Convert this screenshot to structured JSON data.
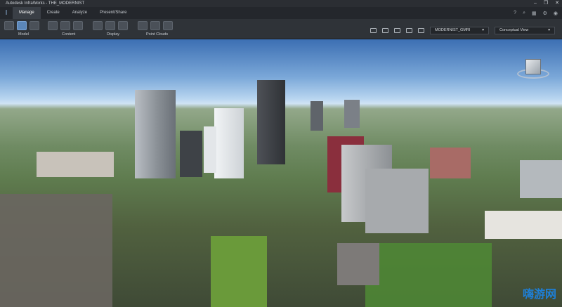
{
  "window": {
    "title": "Autodesk InfraWorks - THE_MODERNIST"
  },
  "tabs": [
    "Manage",
    "Create",
    "Analyze",
    "Present/Share"
  ],
  "ribbon": {
    "groups": [
      "Model",
      "Content",
      "Display",
      "Point Clouds"
    ]
  },
  "toolbar": {
    "proposal": "MODERNIST_GMRI",
    "visual_style": "Conceptual View"
  },
  "watermark": "嗨游网"
}
